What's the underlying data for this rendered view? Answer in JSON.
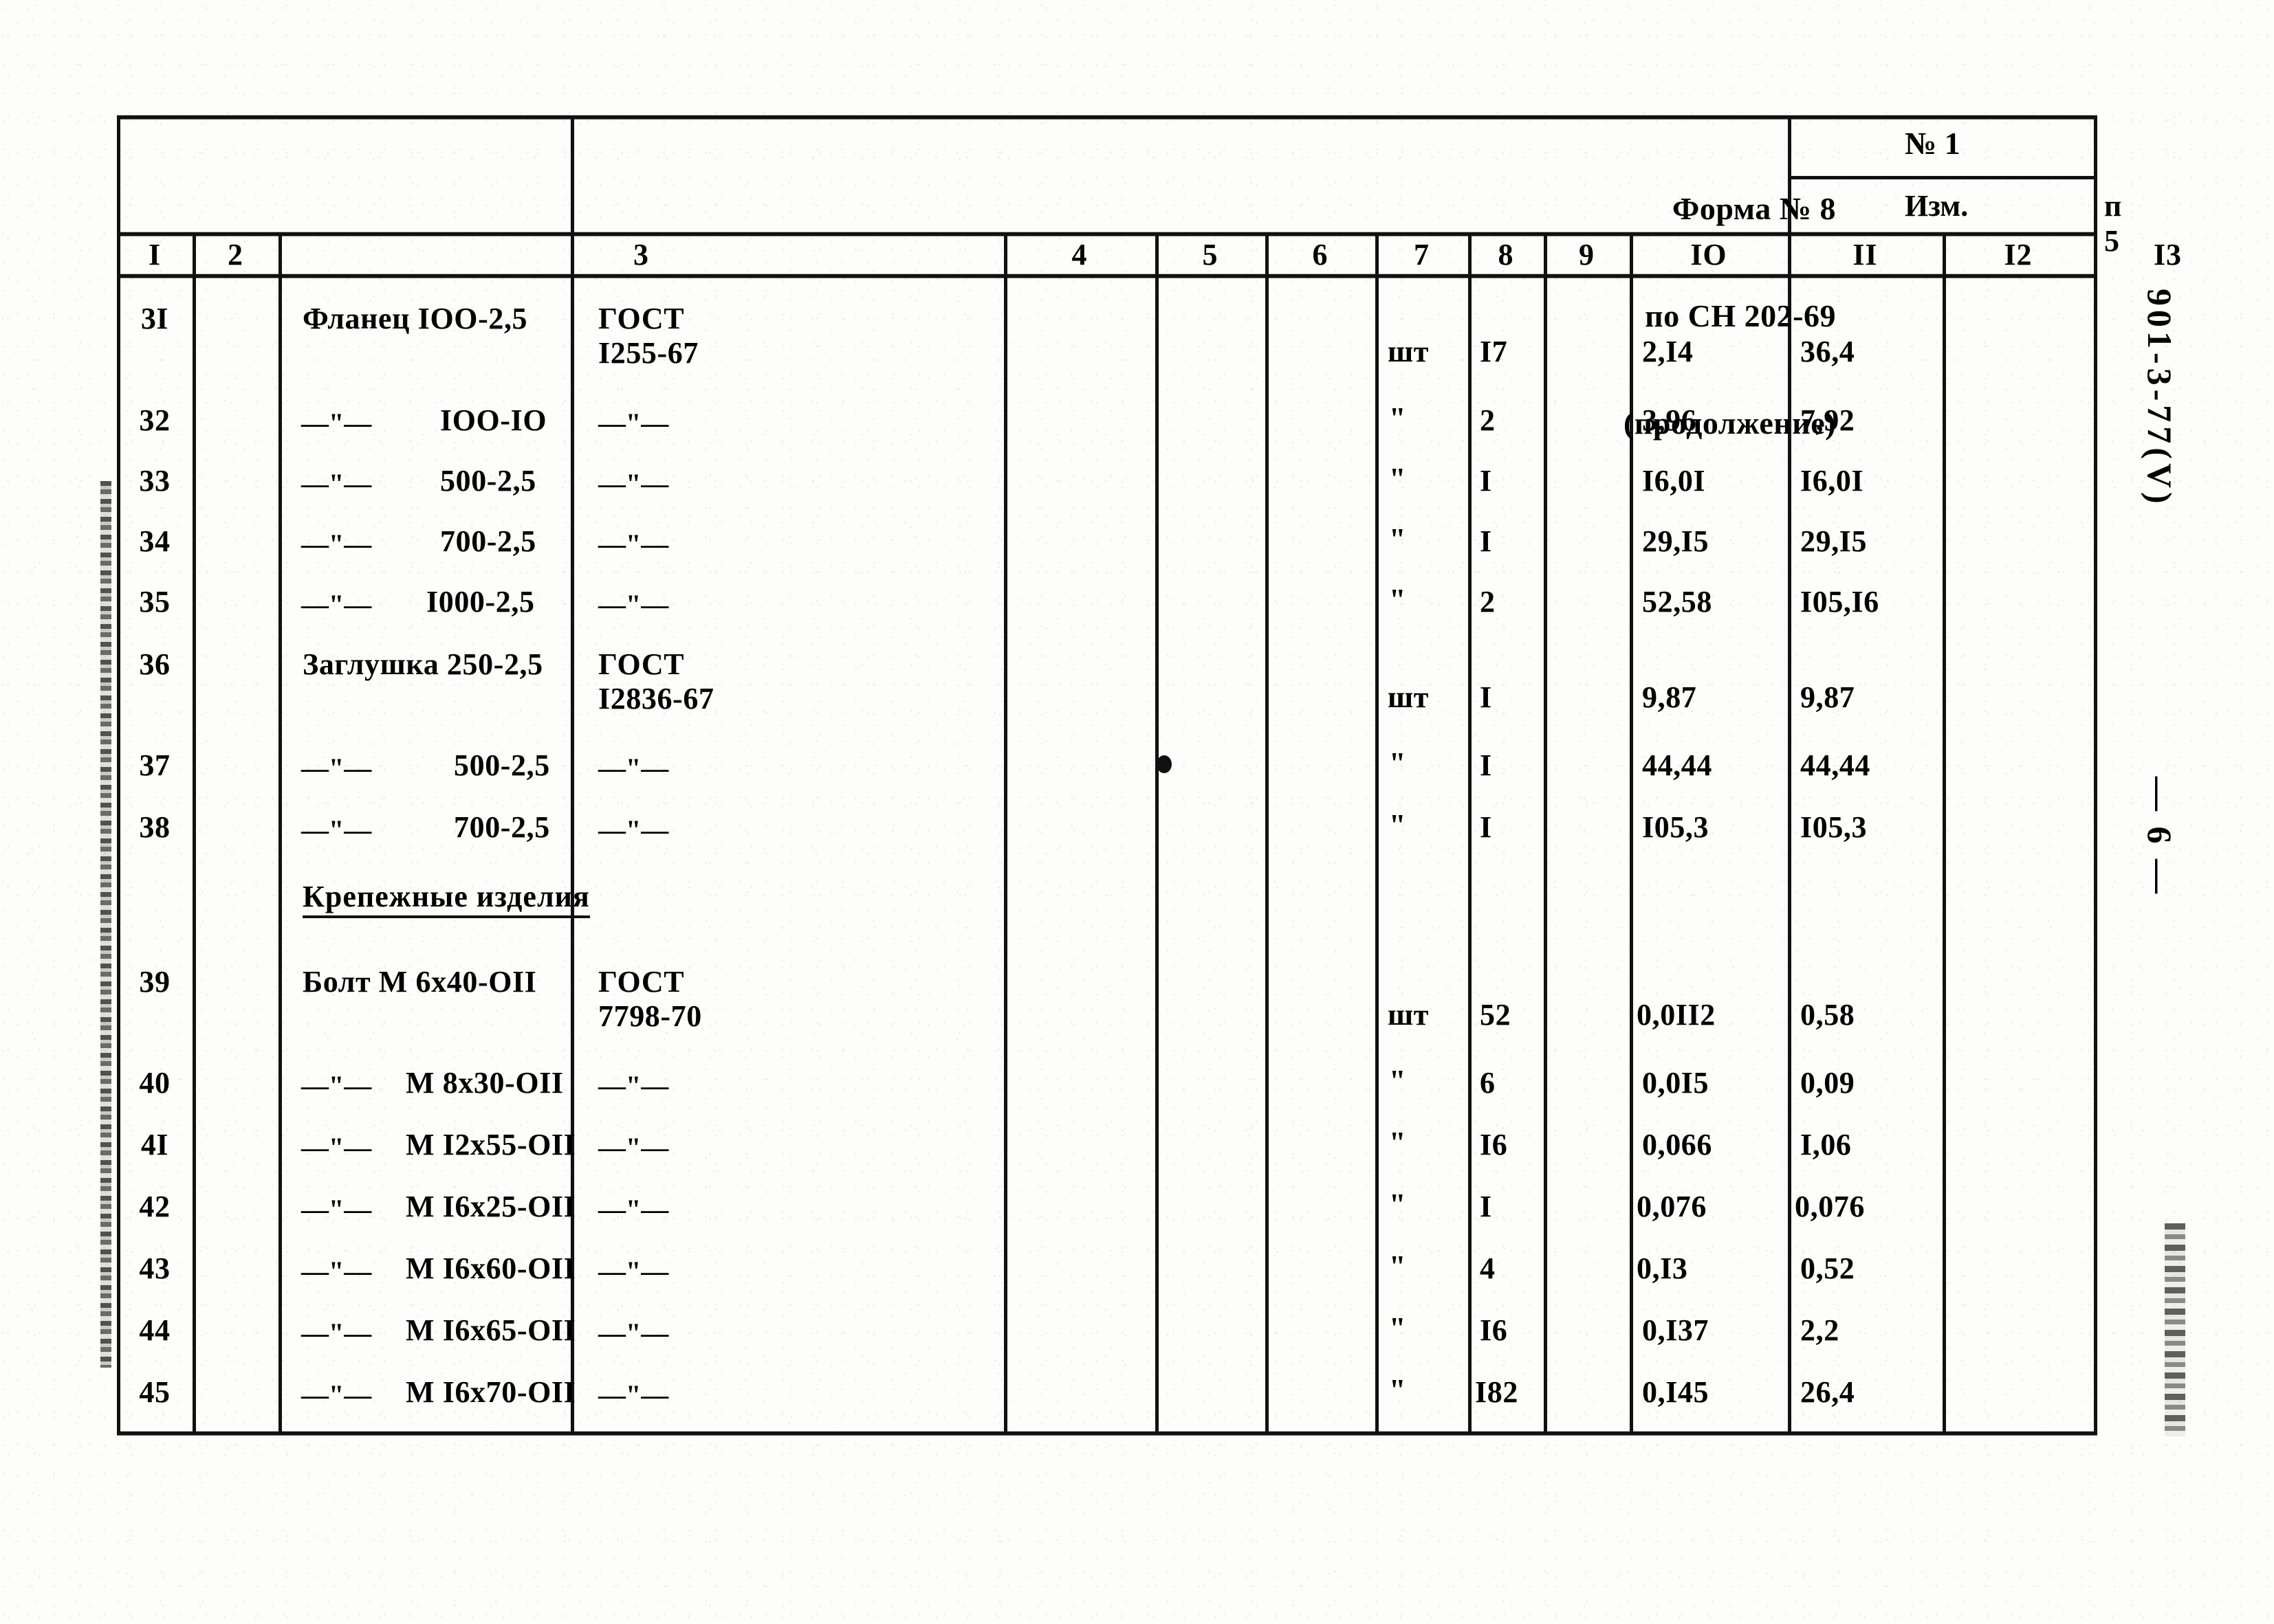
{
  "document": {
    "form_caption_lines": [
      "Форма № 8",
      "по СН 202-69",
      "(продолжение)"
    ],
    "revision_number": "№ 1",
    "revision_label": "Изм.",
    "page_ref": "п 5",
    "doc_code": "901-3-77(V)",
    "page_number": "— 6 —"
  },
  "table": {
    "column_numbers": [
      "I",
      "2",
      "3",
      "4",
      "5",
      "6",
      "7",
      "8",
      "9",
      "IO",
      "II",
      "I2",
      "I3"
    ],
    "section_heading": "Крепежные изделия",
    "ditto_long": "—\"—",
    "ditto_short": "\"",
    "rows": [
      {
        "pos": "3I",
        "mark": "",
        "name": "Фланец IOO-2,5",
        "name_prefix": "",
        "name_size": "",
        "gost": "ГОСТ\nI255-67",
        "c5": "",
        "c6": "",
        "unit": "шт",
        "qty": "I7",
        "mass_unit": "2,I4",
        "mass_total": "36,4",
        "c12": "",
        "c13": ""
      },
      {
        "pos": "32",
        "mark": "",
        "name": "",
        "name_prefix": "—\"—",
        "name_size": "IOO-IO",
        "gost": "—\"—",
        "c5": "",
        "c6": "",
        "unit": "\"",
        "qty": "2",
        "mass_unit": "3,96",
        "mass_total": "7,92",
        "c12": "",
        "c13": ""
      },
      {
        "pos": "33",
        "mark": "",
        "name": "",
        "name_prefix": "—\"—",
        "name_size": "500-2,5",
        "gost": "—\"—",
        "c5": "",
        "c6": "",
        "unit": "\"",
        "qty": "I",
        "mass_unit": "I6,0I",
        "mass_total": "I6,0I",
        "c12": "",
        "c13": ""
      },
      {
        "pos": "34",
        "mark": "",
        "name": "",
        "name_prefix": "—\"—",
        "name_size": "700-2,5",
        "gost": "—\"—",
        "c5": "",
        "c6": "",
        "unit": "\"",
        "qty": "I",
        "mass_unit": "29,I5",
        "mass_total": "29,I5",
        "c12": "",
        "c13": ""
      },
      {
        "pos": "35",
        "mark": "",
        "name": "",
        "name_prefix": "—\"—",
        "name_size": "I000-2,5",
        "gost": "—\"—",
        "c5": "",
        "c6": "",
        "unit": "\"",
        "qty": "2",
        "mass_unit": "52,58",
        "mass_total": "I05,I6",
        "c12": "",
        "c13": ""
      },
      {
        "pos": "36",
        "mark": "",
        "name": "Заглушка 250-2,5",
        "name_prefix": "",
        "name_size": "",
        "gost": "ГОСТ\nI2836-67",
        "c5": "",
        "c6": "",
        "unit": "шт",
        "qty": "I",
        "mass_unit": "9,87",
        "mass_total": "9,87",
        "c12": "",
        "c13": ""
      },
      {
        "pos": "37",
        "mark": "",
        "name": "",
        "name_prefix": "—\"—",
        "name_size": "500-2,5",
        "gost": "—\"—",
        "c5": "",
        "c6": "",
        "unit": "\"",
        "qty": "I",
        "mass_unit": "44,44",
        "mass_total": "44,44",
        "c12": "",
        "c13": ""
      },
      {
        "pos": "38",
        "mark": "",
        "name": "",
        "name_prefix": "—\"—",
        "name_size": "700-2,5",
        "gost": "—\"—",
        "c5": "",
        "c6": "",
        "unit": "\"",
        "qty": "I",
        "mass_unit": "I05,3",
        "mass_total": "I05,3",
        "c12": "",
        "c13": ""
      },
      {
        "pos": "39",
        "mark": "",
        "name": "Болт М 6x40-OII",
        "name_prefix": "",
        "name_size": "",
        "gost": "ГОСТ\n7798-70",
        "c5": "",
        "c6": "",
        "unit": "шт",
        "qty": "52",
        "mass_unit": "0,0II2",
        "mass_total": "0,58",
        "c12": "",
        "c13": ""
      },
      {
        "pos": "40",
        "mark": "",
        "name": "",
        "name_prefix": "—\"—",
        "name_size": "М 8x30-OII",
        "gost": "—\"—",
        "c5": "",
        "c6": "",
        "unit": "\"",
        "qty": "6",
        "mass_unit": "0,0I5",
        "mass_total": "0,09",
        "c12": "",
        "c13": ""
      },
      {
        "pos": "4I",
        "mark": "",
        "name": "",
        "name_prefix": "—\"—",
        "name_size": "М I2x55-OII",
        "gost": "—\"—",
        "c5": "",
        "c6": "",
        "unit": "\"",
        "qty": "I6",
        "mass_unit": "0,066",
        "mass_total": "I,06",
        "c12": "",
        "c13": ""
      },
      {
        "pos": "42",
        "mark": "",
        "name": "",
        "name_prefix": "—\"—",
        "name_size": "М I6x25-OII",
        "gost": "—\"—",
        "c5": "",
        "c6": "",
        "unit": "\"",
        "qty": "I",
        "mass_unit": "0,076",
        "mass_total": "0,076",
        "c12": "",
        "c13": ""
      },
      {
        "pos": "43",
        "mark": "",
        "name": "",
        "name_prefix": "—\"—",
        "name_size": "М I6x60-OII",
        "gost": "—\"—",
        "c5": "",
        "c6": "",
        "unit": "\"",
        "qty": "4",
        "mass_unit": "0,I3",
        "mass_total": "0,52",
        "c12": "",
        "c13": ""
      },
      {
        "pos": "44",
        "mark": "",
        "name": "",
        "name_prefix": "—\"—",
        "name_size": "М I6x65-OII",
        "gost": "—\"—",
        "c5": "",
        "c6": "",
        "unit": "\"",
        "qty": "I6",
        "mass_unit": "0,I37",
        "mass_total": "2,2",
        "c12": "",
        "c13": ""
      },
      {
        "pos": "45",
        "mark": "",
        "name": "",
        "name_prefix": "—\"—",
        "name_size": "М I6x70-OII",
        "gost": "—\"—",
        "c5": "",
        "c6": "",
        "unit": "\"",
        "qty": "I82",
        "mass_unit": "0,I45",
        "mass_total": "26,4",
        "c12": "",
        "c13": ""
      }
    ]
  },
  "colors": {
    "ink": "#111111",
    "paper": "#fdfdfb"
  }
}
